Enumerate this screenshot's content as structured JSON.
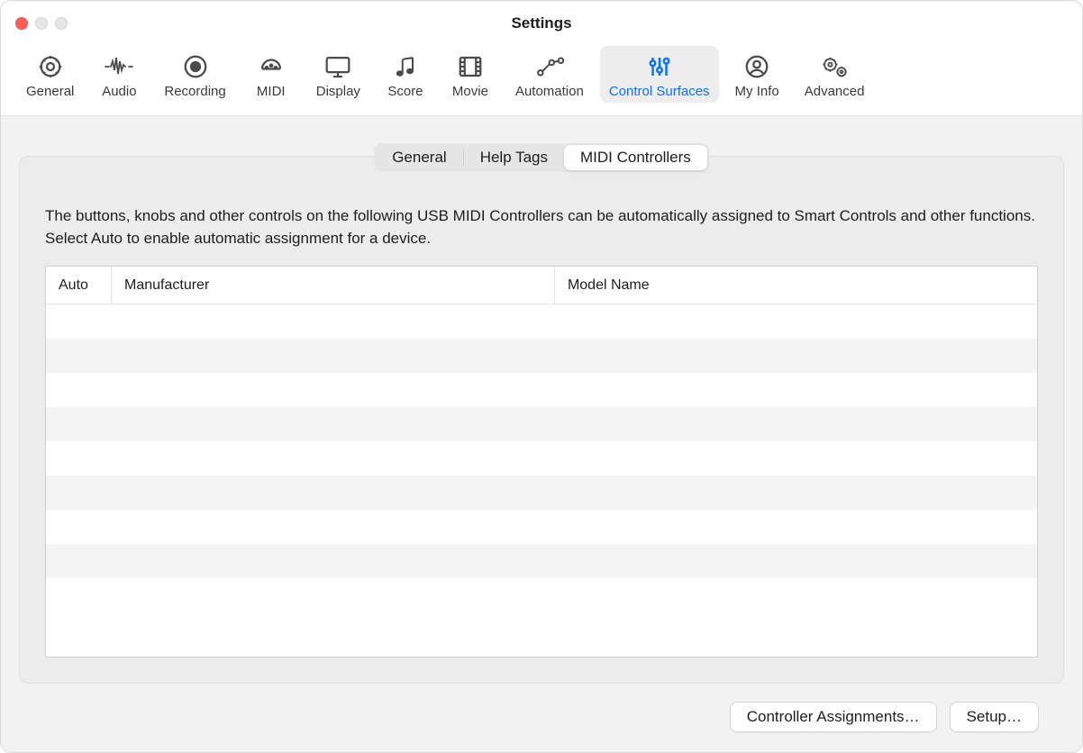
{
  "window": {
    "title": "Settings"
  },
  "toolbar": {
    "items": [
      {
        "label": "General"
      },
      {
        "label": "Audio"
      },
      {
        "label": "Recording"
      },
      {
        "label": "MIDI"
      },
      {
        "label": "Display"
      },
      {
        "label": "Score"
      },
      {
        "label": "Movie"
      },
      {
        "label": "Automation"
      },
      {
        "label": "Control Surfaces"
      },
      {
        "label": "My Info"
      },
      {
        "label": "Advanced"
      }
    ],
    "selected": "Control Surfaces"
  },
  "segmented": {
    "options": [
      {
        "label": "General"
      },
      {
        "label": "Help Tags"
      },
      {
        "label": "MIDI Controllers"
      }
    ],
    "selected": "MIDI Controllers"
  },
  "panel": {
    "description": "The buttons, knobs and other controls on the following USB MIDI Controllers can be automatically assigned to Smart Controls and other functions. Select Auto to enable automatic assignment for a device.",
    "columns": {
      "auto": "Auto",
      "manufacturer": "Manufacturer",
      "model": "Model Name"
    },
    "rows": []
  },
  "footer": {
    "assignments": "Controller Assignments…",
    "setup": "Setup…"
  }
}
